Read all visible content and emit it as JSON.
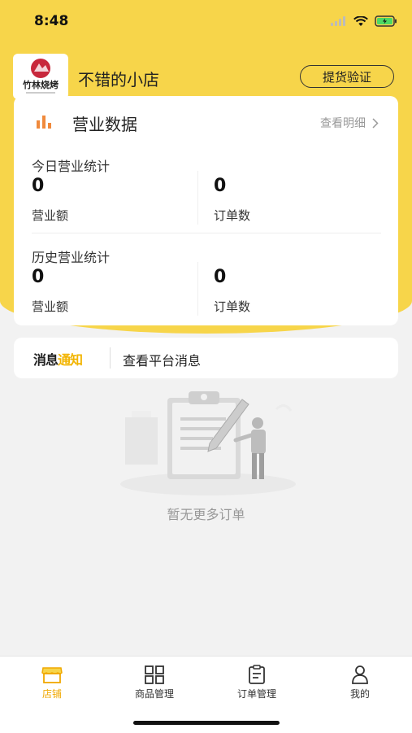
{
  "status_bar": {
    "time": "8:48"
  },
  "shop": {
    "logo_text": "竹林烧烤",
    "name": "不错的小店",
    "pickup_button": "提货验证"
  },
  "business": {
    "title": "营业数据",
    "detail_link": "查看明细",
    "today": {
      "label": "今日营业统计",
      "revenue_value": "0",
      "revenue_label": "营业额",
      "orders_value": "0",
      "orders_label": "订单数"
    },
    "history": {
      "label": "历史营业统计",
      "revenue_value": "0",
      "revenue_label": "营业额",
      "orders_value": "0",
      "orders_label": "订单数"
    }
  },
  "notice": {
    "logo_part1": "消息",
    "logo_part2": "通知",
    "text": "查看平台消息"
  },
  "empty_state": {
    "text": "暂无更多订单"
  },
  "tabs": [
    {
      "label": "店铺",
      "icon": "store-icon",
      "active": true
    },
    {
      "label": "商品管理",
      "icon": "grid-icon",
      "active": false
    },
    {
      "label": "订单管理",
      "icon": "clipboard-icon",
      "active": false
    },
    {
      "label": "我的",
      "icon": "person-icon",
      "active": false
    }
  ],
  "colors": {
    "accent": "#f7d54a",
    "active_tab": "#f0a800",
    "chart_icon": "#f08a3c"
  }
}
